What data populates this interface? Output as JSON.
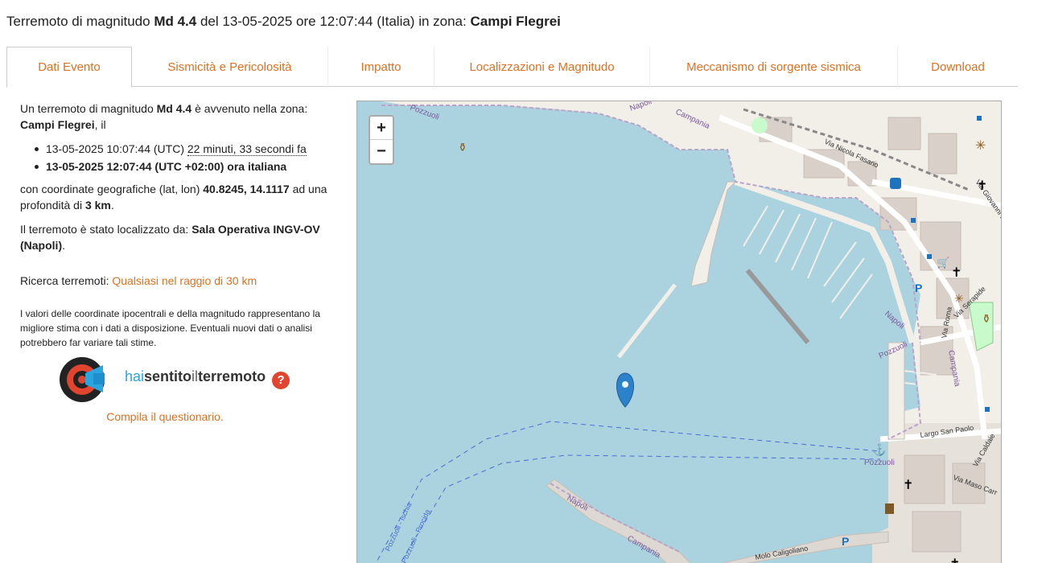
{
  "title": {
    "prefix": "Terremoto di magnitudo ",
    "magnitude": "Md 4.4",
    "middle": " del 13-05-2025 ore 12:07:44 (Italia) in zona: ",
    "zone": "Campi Flegrei"
  },
  "tabs": [
    {
      "label": "Dati Evento",
      "active": true
    },
    {
      "label": "Sismicità e Pericolosità"
    },
    {
      "label": "Impatto"
    },
    {
      "label": "Localizzazioni e Magnitudo"
    },
    {
      "label": "Meccanismo di sorgente sismica"
    },
    {
      "label": "Download"
    }
  ],
  "info": {
    "intro_a": "Un terremoto di magnitudo ",
    "magnitude": "Md 4.4",
    "intro_b": " è avvenuto nella zona: ",
    "zone": "Campi Flegrei",
    "intro_c": ", il",
    "utc_time": "13-05-2025 10:07:44 (UTC) ",
    "ago": "22 minuti, 33 secondi fa",
    "local_time": "13-05-2025 12:07:44 (UTC +02:00) ora italiana",
    "coords_text": "con coordinate geografiche (lat, lon) ",
    "coords": "40.8245, 14.1117",
    "depth_text": " ad una profondità di ",
    "depth": "3 km",
    "located_text": "Il terremoto è stato localizzato da: ",
    "located_by": "Sala Operativa INGV-OV (Napoli)",
    "search_label": "Ricerca terremoti: ",
    "search_link": "Qualsiasi nel raggio di 30 km",
    "note": "I valori delle coordinate ipocentrali e della magnitudo rappresentano la migliore stima con i dati a disposizione. Eventuali nuovi dati o analisi potrebbero far variare tali stime."
  },
  "hst": {
    "hai": "hai",
    "sentito": "sentito",
    "il": "il",
    "terremoto": "terremoto",
    "help": "?",
    "compila": "Compila il questionario."
  },
  "map": {
    "zoom_in": "+",
    "zoom_out": "−",
    "labels": {
      "pozzuoli_top": "Pozzuoli",
      "napoli_top": "Napoli",
      "campania_top": "Campania",
      "via_nicola_fasano": "Via Nicola Fasano",
      "via_giovanni": "Via Giovanni B",
      "via_serapide": "Via Serapide",
      "via_roma": "Via Roma",
      "napoli_right": "Napoli",
      "pozzuoli_right": "Pozzuoli",
      "campania_right": "Campania",
      "largo_san_paolo": "Largo San Paolo",
      "via_caldaie": "Via Caldaie",
      "via_maso": "Via Maso Carr",
      "pozzuoli_port": "Pozzuoli",
      "pozzuoli_ischia": "Pozzuoli - Ischia",
      "pozzuoli_procida": "Pozzuoli - Procida",
      "napoli_bottom": "Napoli",
      "campania_bottom": "Campania",
      "molo_caligoliano": "Molo Caligoliano",
      "parking": "P"
    },
    "colors": {
      "water": "#aad3df",
      "land": "#f2efe9",
      "pier": "#ddd8d2",
      "border": "#b9a3c9",
      "marker": "#2b82cb"
    }
  }
}
